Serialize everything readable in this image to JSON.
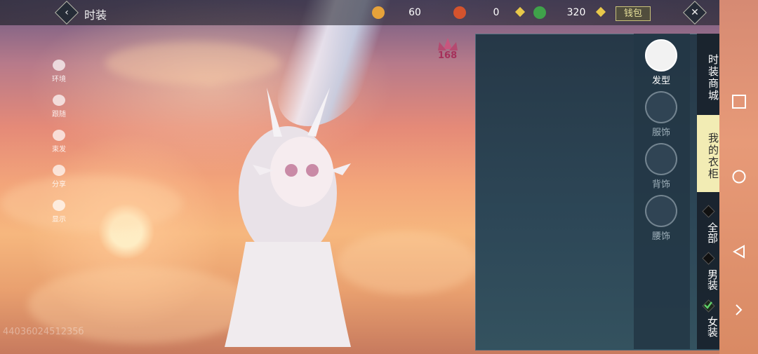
{
  "header": {
    "title": "时装",
    "currencies": [
      {
        "name": "gold-coin",
        "value": "60",
        "color": "#e6a23a"
      },
      {
        "name": "red-jade",
        "value": "0",
        "color": "#d4532d"
      },
      {
        "name": "green-jade",
        "value": "320",
        "color": "#3fa24a"
      }
    ],
    "wallet_label": "钱包"
  },
  "left_tools": [
    {
      "icon": "environment-icon",
      "label": "环境"
    },
    {
      "icon": "follow-icon",
      "label": "跟随"
    },
    {
      "icon": "hair-tie-icon",
      "label": "束发"
    },
    {
      "icon": "share-icon",
      "label": "分享"
    },
    {
      "icon": "eye-icon",
      "label": "显示"
    }
  ],
  "badge": {
    "value": "168",
    "icon": "lotus-icon"
  },
  "categories": [
    {
      "label": "发型",
      "icon": "hair-icon",
      "active": true
    },
    {
      "label": "服饰",
      "icon": "outfit-icon",
      "active": false
    },
    {
      "label": "背饰",
      "icon": "back-accessory-icon",
      "active": false
    },
    {
      "label": "腰饰",
      "icon": "waist-accessory-icon",
      "active": false
    }
  ],
  "tabs": [
    {
      "label": "时装商城",
      "active": false
    },
    {
      "label": "我的衣柜",
      "active": true
    }
  ],
  "filters": [
    {
      "label": "全部",
      "checked": false
    },
    {
      "label": "男装",
      "checked": false
    },
    {
      "label": "女装",
      "checked": true
    }
  ],
  "uid": "4403602451235б",
  "colors": {
    "accent": "#f2ecb4",
    "panel": "#2d4757"
  }
}
